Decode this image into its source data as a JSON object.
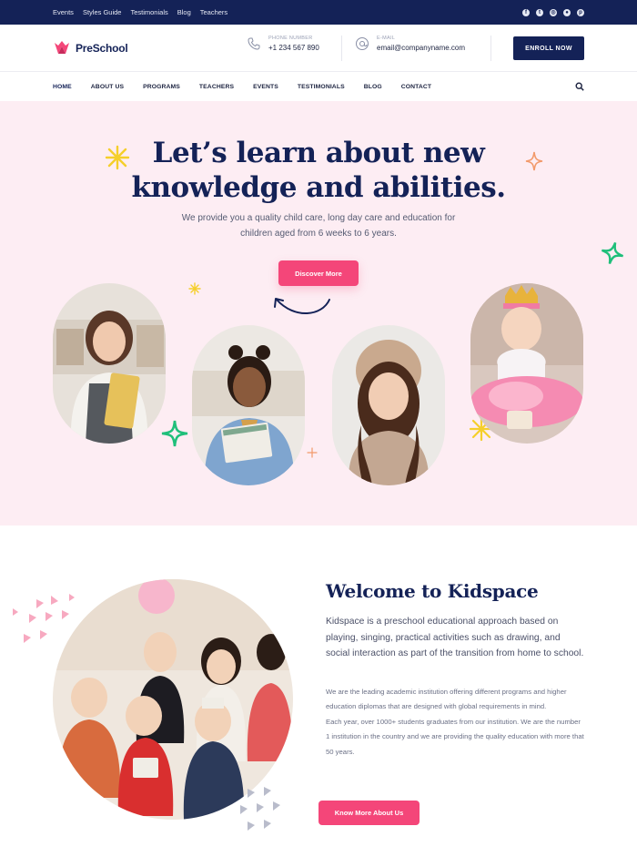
{
  "topbar": {
    "links": [
      "Events",
      "Styles Guide",
      "Testimonials",
      "Blog",
      "Teachers"
    ],
    "social": [
      "facebook-icon",
      "twitter-icon",
      "instagram-icon",
      "dribbble-icon",
      "pinterest-icon"
    ]
  },
  "header": {
    "logo_text": "PreSchool",
    "phone_label": "PHONE NUMBER",
    "phone_value": "+1 234 567 890",
    "email_label": "E-MAIL",
    "email_value": "email@companyname.com",
    "enroll_label": "ENROLL NOW"
  },
  "nav": {
    "items": [
      "HOME",
      "ABOUT US",
      "PROGRAMS",
      "TEACHERS",
      "EVENTS",
      "TESTIMONIALS",
      "BLOG",
      "CONTACT"
    ],
    "active": "HOME"
  },
  "hero": {
    "title_line1": "Let’s learn about new",
    "title_line2": "knowledge and abilities.",
    "subtitle": "We provide you a quality child care, long day care and education for children aged from 6 weeks to 6 years.",
    "button_label": "Discover More"
  },
  "welcome": {
    "title": "Welcome to Kidspace",
    "lead": "Kidspace is a preschool educational approach based on playing, singing, practical activities such as drawing, and social interaction as part of the transition from home to school.",
    "paragraph1": "We are the leading academic institution offering different programs and higher education diplomas that are designed with global requirements in mind.",
    "paragraph2": "Each year, over 1000+ students graduates from our institution. We are the number 1 institution in the country and we are providing the quality education with more that 50 years.",
    "button_label": "Know More About Us"
  },
  "colors": {
    "navy": "#142257",
    "pink": "#f44679",
    "hero_bg": "#fdedf3",
    "yellow": "#f5d23a",
    "green": "#1fbf7a",
    "orange": "#f29a6b"
  }
}
